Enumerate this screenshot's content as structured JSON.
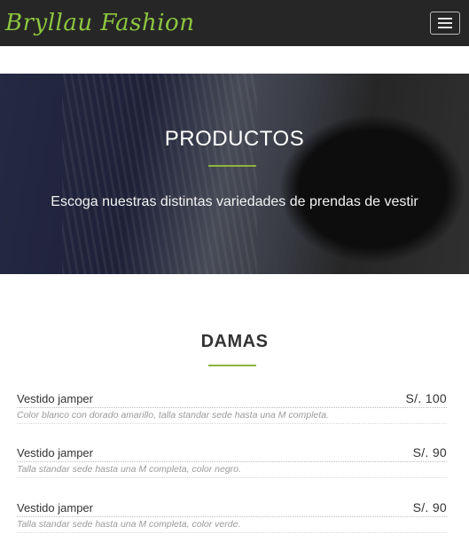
{
  "navbar": {
    "brand": "Bryllau Fashion",
    "menu_icon": "hamburger-menu-icon"
  },
  "hero": {
    "title": "PRODUCTOS",
    "subtitle": "Escoga nuestras distintas variedades de prendas de vestir"
  },
  "section": {
    "title": "DAMAS"
  },
  "products": [
    {
      "name": "Vestido jamper",
      "price": "S/. 100",
      "description": "Color blanco con dorado amarillo, talla standar sede hasta una M completa."
    },
    {
      "name": "Vestido jamper",
      "price": "S/. 90",
      "description": "Talla standar sede hasta una M completa, color negro."
    },
    {
      "name": "Vestido jamper",
      "price": "S/. 90",
      "description": "Talla standar sede hasta una M completa, color verde."
    }
  ],
  "colors": {
    "navbar_bg": "#262626",
    "brand": "#8dc63f",
    "accent_rule": "#8db33a"
  }
}
